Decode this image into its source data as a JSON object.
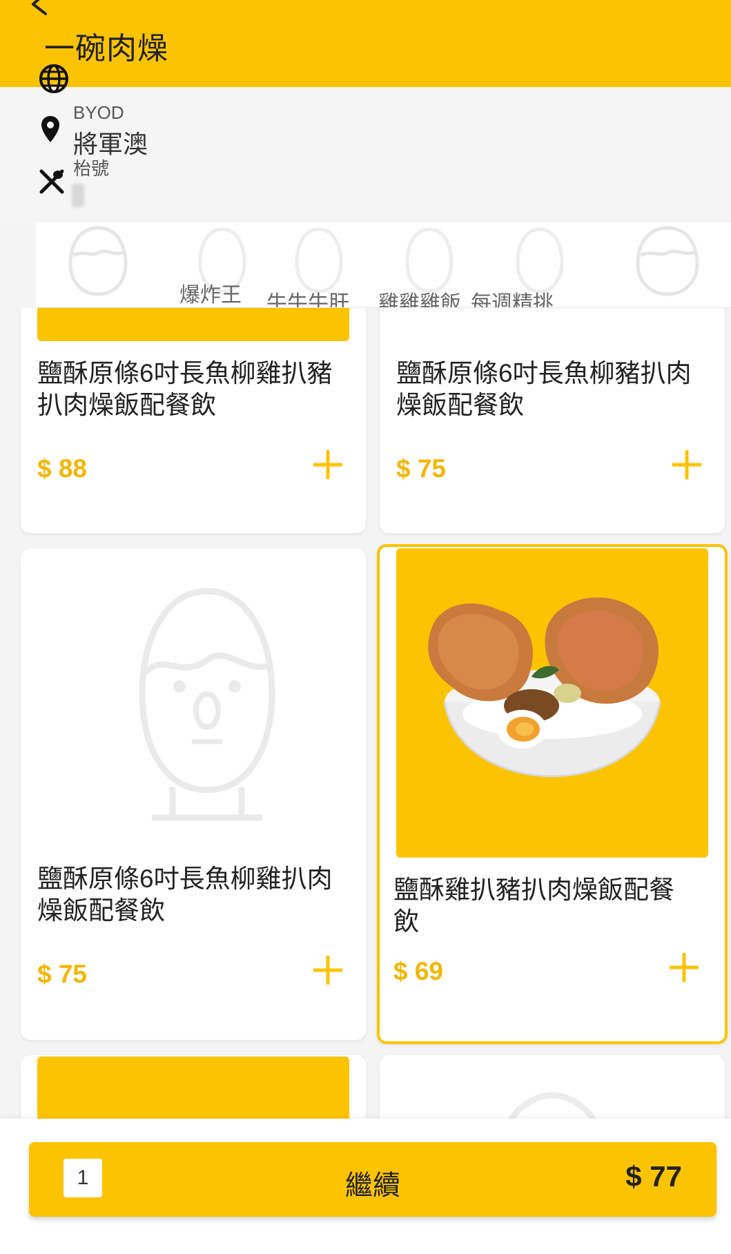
{
  "header": {
    "back_icon": "back-arrow-icon",
    "store_name": "一碗肉燥",
    "language_icon": "globe-icon"
  },
  "info": {
    "mode": "BYOD",
    "branch": "將軍澳",
    "table_label": "枱號",
    "location_icon": "map-pin-icon",
    "dining_icon": "utensils-icon"
  },
  "categories": [
    {
      "label": "爆炸王"
    },
    {
      "label": "牛牛牛肝"
    },
    {
      "label": "雞雞雞飯"
    },
    {
      "label": "每週精挑"
    }
  ],
  "products": [
    {
      "name": "鹽酥原條6吋長魚柳雞扒豬扒肉燥飯配餐飲",
      "price": "$ 88",
      "image": "yellow-plate"
    },
    {
      "name": "鹽酥原條6吋長魚柳豬扒肉燥飯配餐飲",
      "price": "$ 75",
      "image": "placeholder-face"
    },
    {
      "name": "鹽酥原條6吋長魚柳雞扒肉燥飯配餐飲",
      "price": "$ 75",
      "image": "placeholder-face"
    },
    {
      "name": "鹽酥雞扒豬扒肉燥飯配餐飲",
      "price": "$ 69",
      "image": "rice-bowl-photo",
      "selected": true
    }
  ],
  "cart": {
    "quantity": "1",
    "continue_label": "繼續",
    "total": "$ 77"
  },
  "colors": {
    "accent": "#fcc300",
    "price": "#f2b600",
    "background": "#f4f4f4"
  }
}
